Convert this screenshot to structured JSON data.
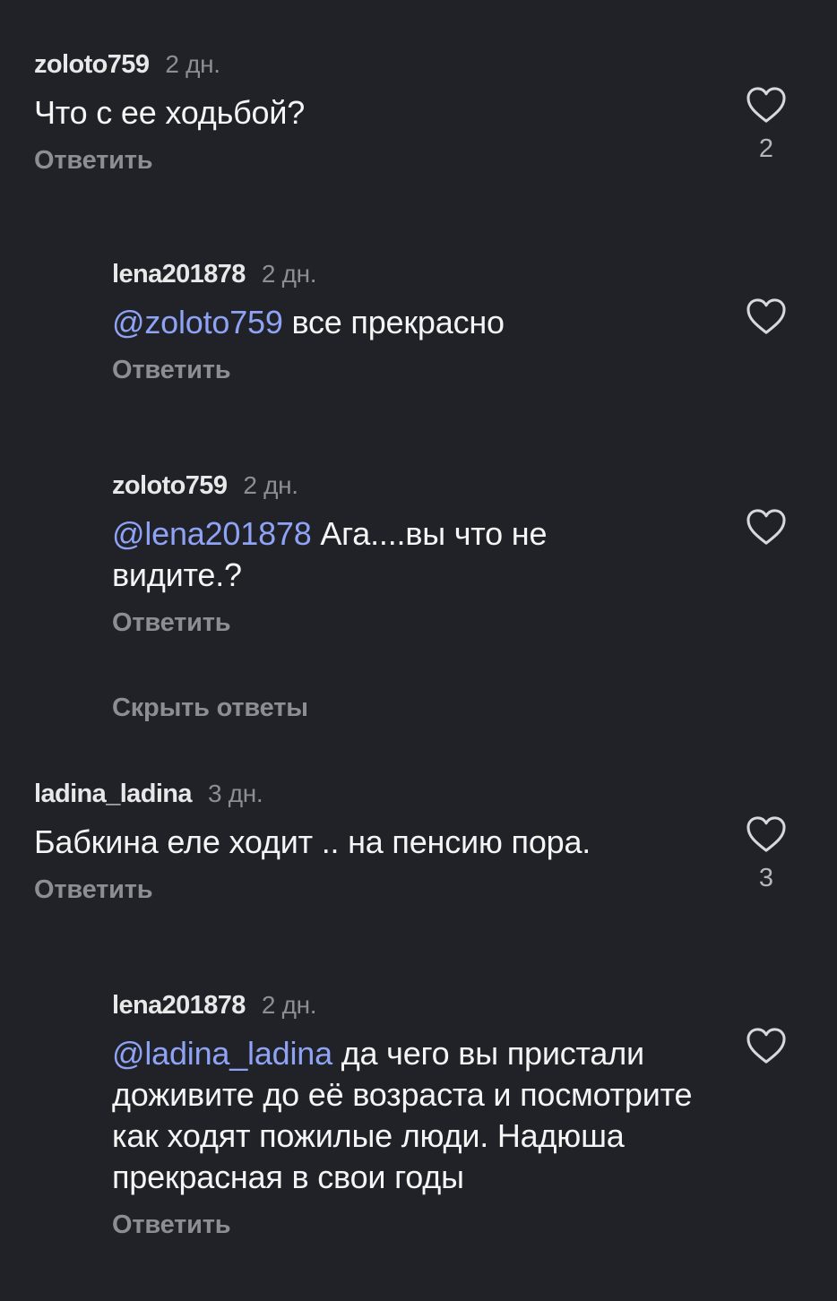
{
  "comments": [
    {
      "username": "zoloto759",
      "time": "2 дн.",
      "mention": "",
      "text": "Что с ее ходьбой?",
      "reply_label": "Ответить",
      "likes": "2"
    },
    {
      "username": "lena201878",
      "time": "2 дн.",
      "mention": "@zoloto759",
      "text": " все прекрасно",
      "reply_label": "Ответить",
      "likes": ""
    },
    {
      "username": "zoloto759",
      "time": "2 дн.",
      "mention": "@lena201878",
      "text": " Ага....вы что не видите.?",
      "reply_label": "Ответить",
      "likes": ""
    },
    {
      "username": "ladina_ladina",
      "time": "3 дн.",
      "mention": "",
      "text": "Бабкина еле ходит .. на пенсию пора.",
      "reply_label": "Ответить",
      "likes": "3"
    },
    {
      "username": "lena201878",
      "time": "2 дн.",
      "mention": "@ladina_ladina",
      "text": " да чего вы пристали доживите до её возраста и посмотрите как ходят пожилые люди. Надюша прекрасная в свои годы",
      "reply_label": "Ответить",
      "likes": ""
    }
  ],
  "hide_replies_label": "Скрыть ответы",
  "icons": {
    "like": "heart-outline-icon"
  },
  "colors": {
    "background": "#212227",
    "mention": "#8ea3f5",
    "secondary_text": "#8d8e93"
  }
}
